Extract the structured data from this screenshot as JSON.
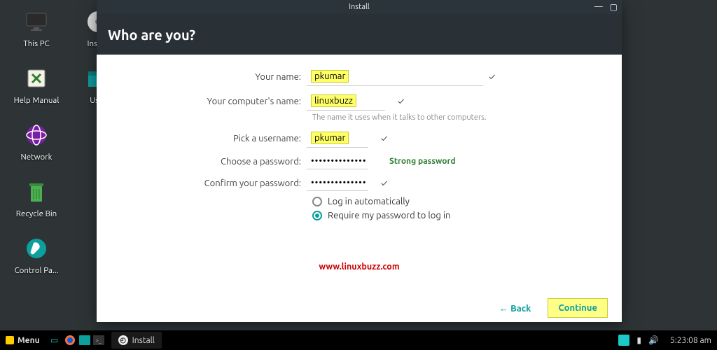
{
  "desktop": {
    "col1": [
      {
        "name": "this-pc",
        "label": "This PC"
      },
      {
        "name": "help-manual",
        "label": "Help Manual"
      },
      {
        "name": "network",
        "label": "Network"
      },
      {
        "name": "recycle-bin",
        "label": "Recycle Bin"
      },
      {
        "name": "control-panel",
        "label": "Control Pa..."
      }
    ],
    "col2": [
      {
        "name": "install",
        "label": "Install"
      },
      {
        "name": "user",
        "label": "User"
      }
    ]
  },
  "window": {
    "title": "Install",
    "heading": "Who are you?",
    "form": {
      "name_label": "Your name:",
      "name_value": "pkumar",
      "computer_label": "Your computer's name:",
      "computer_value": "linuxbuzz",
      "computer_hint": "The name it uses when it talks to other computers.",
      "username_label": "Pick a username:",
      "username_value": "pkumar",
      "password_label": "Choose a password:",
      "password_dots": "••••••••••••••",
      "password_strength": "Strong password",
      "confirm_label": "Confirm your password:",
      "confirm_dots": "••••••••••••••",
      "radio_auto": "Log in automatically",
      "radio_require": "Require my password to log in"
    },
    "watermark": "www.linuxbuzz.com",
    "back_label": "Back",
    "continue_label": "Continue"
  },
  "taskbar": {
    "menu_label": "Menu",
    "task_label": "Install",
    "clock": "5:23:08 am"
  }
}
